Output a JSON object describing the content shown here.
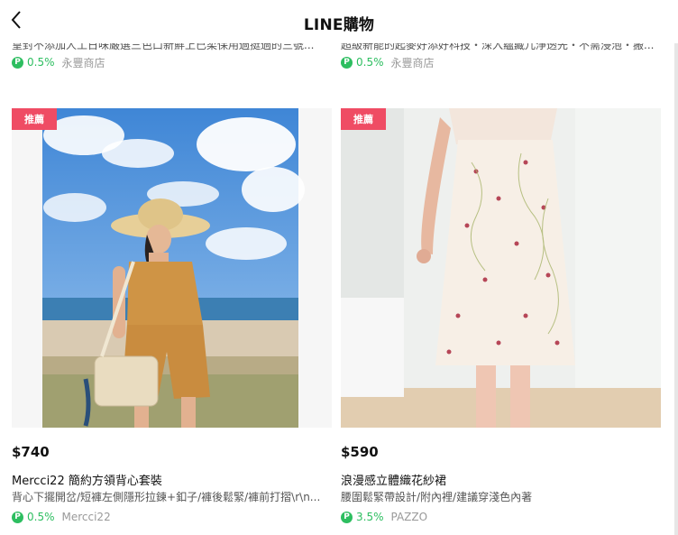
{
  "header": {
    "title": "LINE購物"
  },
  "prev_row": [
    {
      "desc_cut": "皇封不添加人工日味嚴選三色口新鮮上已柔保用過挺過的三號...",
      "points": "0.5%",
      "shop": "永豐商店"
    },
    {
      "desc_cut": "超級新能的起麥好添好科技・深入蘊藏儿淨透先・不需浸泡・搬...",
      "points": "0.5%",
      "shop": "永豐商店"
    }
  ],
  "products": [
    {
      "badge": "推薦",
      "price": "$740",
      "name": "Mercci22 簡約方領背心套裝",
      "desc": "背心下擺開岔/短褲左側隱形拉鍊+釦子/褲後鬆緊/褲前打摺\\r\\n...",
      "points": "0.5%",
      "shop": "Mercci22"
    },
    {
      "badge": "推薦",
      "price": "$590",
      "name": "浪漫感立體織花紗裙",
      "desc": "腰圍鬆緊帶設計/附內裡/建議穿淺色內著",
      "points": "3.5%",
      "shop": "PAZZO"
    }
  ],
  "icons": {
    "back": "chevron-left-icon",
    "points": "line-points-icon"
  },
  "colors": {
    "badge": "#ef4c64",
    "points_green": "#2dbe60",
    "shop_gray": "#999999"
  }
}
